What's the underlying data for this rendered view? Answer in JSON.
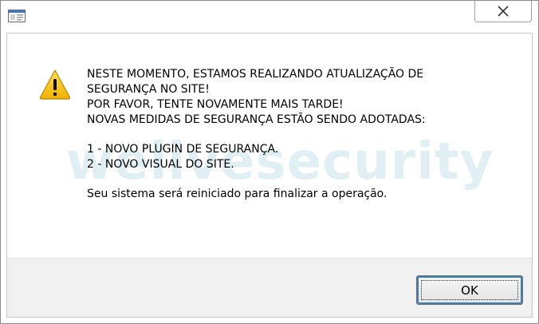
{
  "window": {
    "close_glyph": "✕",
    "app_icon": "window-app-icon"
  },
  "watermark": {
    "prefix": "welive",
    "suffix": "security"
  },
  "dialog": {
    "icon": "warning-icon",
    "lines": [
      "NESTE MOMENTO, ESTAMOS REALIZANDO ATUALIZAÇÃO DE",
      "SEGURANÇA NO SITE!",
      "POR FAVOR, TENTE NOVAMENTE MAIS TARDE!",
      "NOVAS MEDIDAS DE SEGURANÇA ESTÃO SENDO ADOTADAS:"
    ],
    "items": [
      "1 - NOVO PLUGIN DE SEGURANÇA.",
      "2 - NOVO VISUAL DO SITE."
    ],
    "footer": "Seu sistema será reiniciado para finalizar a operação."
  },
  "buttons": {
    "ok_label": "OK"
  },
  "colors": {
    "warning_yellow": "#f5c400",
    "button_focus": "#3c7fb1",
    "watermark": "#a9d3df"
  }
}
